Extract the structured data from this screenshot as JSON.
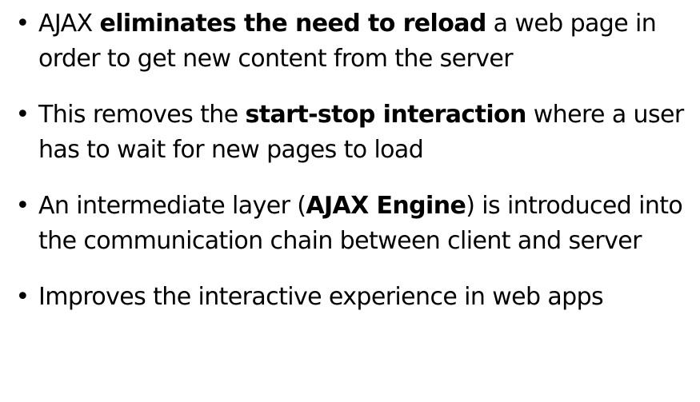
{
  "bullet_glyph": "•",
  "bullets": [
    {
      "parts": [
        {
          "text": "AJAX ",
          "bold": false
        },
        {
          "text": "eliminates the need to reload",
          "bold": true
        },
        {
          "text": " a web page in order to get new content from the server",
          "bold": false
        }
      ]
    },
    {
      "parts": [
        {
          "text": "This removes the ",
          "bold": false
        },
        {
          "text": "start-stop interaction",
          "bold": true
        },
        {
          "text": " where a user has to wait for new pages to load",
          "bold": false
        }
      ]
    },
    {
      "parts": [
        {
          "text": "An intermediate layer (",
          "bold": false
        },
        {
          "text": "AJAX Engine",
          "bold": true
        },
        {
          "text": ") is introduced into the communication chain between client and server",
          "bold": false
        }
      ]
    },
    {
      "parts": [
        {
          "text": "Improves the interactive experience in web apps",
          "bold": false
        }
      ]
    }
  ]
}
